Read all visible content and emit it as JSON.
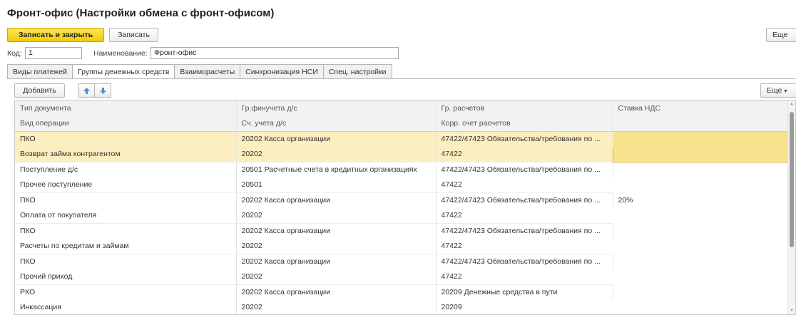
{
  "window": {
    "title": "Фронт-офис (Настройки обмена с фронт-офисом)"
  },
  "toolbar": {
    "save_close_label": "Записать и закрыть",
    "save_label": "Записать",
    "more_label": "Еще",
    "more_arrow": "▾"
  },
  "fields": {
    "code_label": "Код:",
    "code_value": "1",
    "name_label": "Наименование:",
    "name_value": "Фронт-офис"
  },
  "tabs": [
    {
      "label": "Виды платежей",
      "active": false
    },
    {
      "label": "Группы денежных средств",
      "active": true
    },
    {
      "label": "Взаиморасчеты",
      "active": false
    },
    {
      "label": "Синхронизация НСИ",
      "active": false
    },
    {
      "label": "Спец. настройки",
      "active": false
    }
  ],
  "table_toolbar": {
    "add_label": "Добавить",
    "more_label": "Еще",
    "more_arrow": "▾"
  },
  "table": {
    "headers_row1": [
      "Тип документа",
      "Гр.финучета д/с",
      "Гр. расчетов",
      "Ставка НДС"
    ],
    "headers_row2": [
      "Вид операции",
      "Сч. учета д/с",
      "Корр. счет расчетов",
      ""
    ],
    "rows": [
      {
        "doc_type": "ПКО",
        "fin_group": "20202 Касса организации",
        "settle_group": "47422/47423 Обязательства/требования по ...",
        "vat": "",
        "op_type": "Возврат займа контрагентом",
        "account": "20202",
        "corr_account": "47422"
      },
      {
        "doc_type": "Поступление д/с",
        "fin_group": "20501 Расчетные счета в кредитных организациях",
        "settle_group": "47422/47423 Обязательства/требования по ...",
        "vat": "",
        "op_type": "Прочее поступление",
        "account": "20501",
        "corr_account": "47422"
      },
      {
        "doc_type": "ПКО",
        "fin_group": "20202 Касса организации",
        "settle_group": "47422/47423 Обязательства/требования по ...",
        "vat": "20%",
        "op_type": "Оплата от покупателя",
        "account": "20202",
        "corr_account": "47422"
      },
      {
        "doc_type": "ПКО",
        "fin_group": "20202 Касса организации",
        "settle_group": "47422/47423 Обязательства/требования по ...",
        "vat": "",
        "op_type": "Расчеты по кредитам и займам",
        "account": "20202",
        "corr_account": "47422"
      },
      {
        "doc_type": "ПКО",
        "fin_group": "20202 Касса организации",
        "settle_group": "47422/47423 Обязательства/требования по ...",
        "vat": "",
        "op_type": "Прочий приход",
        "account": "20202",
        "corr_account": "47422"
      },
      {
        "doc_type": "РКО",
        "fin_group": "20202 Касса организации",
        "settle_group": "20209 Денежные средства в пути",
        "vat": "",
        "op_type": "Инкассация",
        "account": "20202",
        "corr_account": "20209"
      }
    ]
  },
  "scrollbar": {
    "up_glyph": "▲",
    "down_glyph": "▼"
  },
  "colors": {
    "primary_button": "#f1cc00",
    "selected_row": "#fbeebf",
    "selected_cell": "#f7e28d",
    "arrow_icon": "#4a8fd8"
  }
}
